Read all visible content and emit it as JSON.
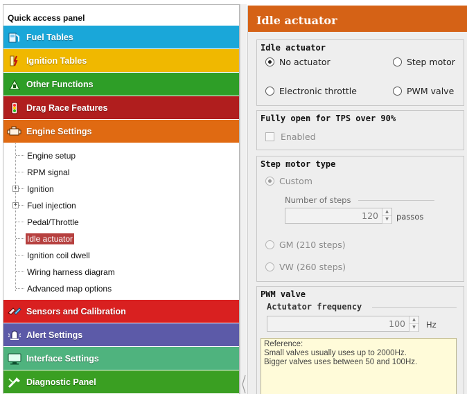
{
  "quick_access": {
    "title": "Quick access panel",
    "categories_top": [
      {
        "label": "Fuel Tables",
        "color": "#1aa7d9",
        "icon": "fuel-icon"
      },
      {
        "label": "Ignition Tables",
        "color": "#f0b800",
        "icon": "ignition-icon"
      },
      {
        "label": "Other Functions",
        "color": "#2e9e27",
        "icon": "functions-icon"
      },
      {
        "label": "Drag Race Features",
        "color": "#b01e1e",
        "icon": "drag-race-icon"
      },
      {
        "label": "Engine Settings",
        "color": "#e06a12",
        "icon": "engine-icon"
      }
    ],
    "tree": [
      {
        "label": "Engine setup",
        "expandable": false
      },
      {
        "label": "RPM signal",
        "expandable": false
      },
      {
        "label": "Ignition",
        "expandable": true
      },
      {
        "label": "Fuel injection",
        "expandable": true
      },
      {
        "label": "Pedal/Throttle",
        "expandable": false
      },
      {
        "label": "Idle actuator",
        "expandable": false,
        "selected": true
      },
      {
        "label": "Ignition coil dwell",
        "expandable": false
      },
      {
        "label": "Wiring harness diagram",
        "expandable": false
      },
      {
        "label": "Advanced map options",
        "expandable": false
      }
    ],
    "categories_bottom": [
      {
        "label": "Sensors and Calibration",
        "color": "#d92020",
        "icon": "sensors-icon"
      },
      {
        "label": "Alert Settings",
        "color": "#5c5aa8",
        "icon": "alert-icon"
      },
      {
        "label": "Interface Settings",
        "color": "#4fb37e",
        "icon": "interface-icon"
      },
      {
        "label": "Diagnostic Panel",
        "color": "#3a9f22",
        "icon": "diagnostic-icon"
      }
    ]
  },
  "panel": {
    "title": "Idle actuator",
    "idle_group": {
      "title": "Idle actuator",
      "options": [
        "No actuator",
        "Step motor",
        "Electronic throttle",
        "PWM valve"
      ],
      "selected": "No actuator"
    },
    "tps_group": {
      "title": "Fully open for TPS over 90%",
      "checkbox_label": "Enabled",
      "checked": false
    },
    "step_group": {
      "title": "Step motor type",
      "custom_label": "Custom",
      "steps_label": "Number of steps",
      "steps_value": "120",
      "steps_unit": "passos",
      "gm_label": "GM (210 steps)",
      "vw_label": "VW (260 steps)"
    },
    "pwm_group": {
      "title": "PWM valve",
      "freq_label": "Actutator frequency",
      "freq_value": "100",
      "freq_unit": "Hz",
      "note_lines": [
        "Reference:",
        "Small valves usually uses up to 2000Hz.",
        "Bigger valves uses between 50 and 100Hz."
      ]
    }
  }
}
